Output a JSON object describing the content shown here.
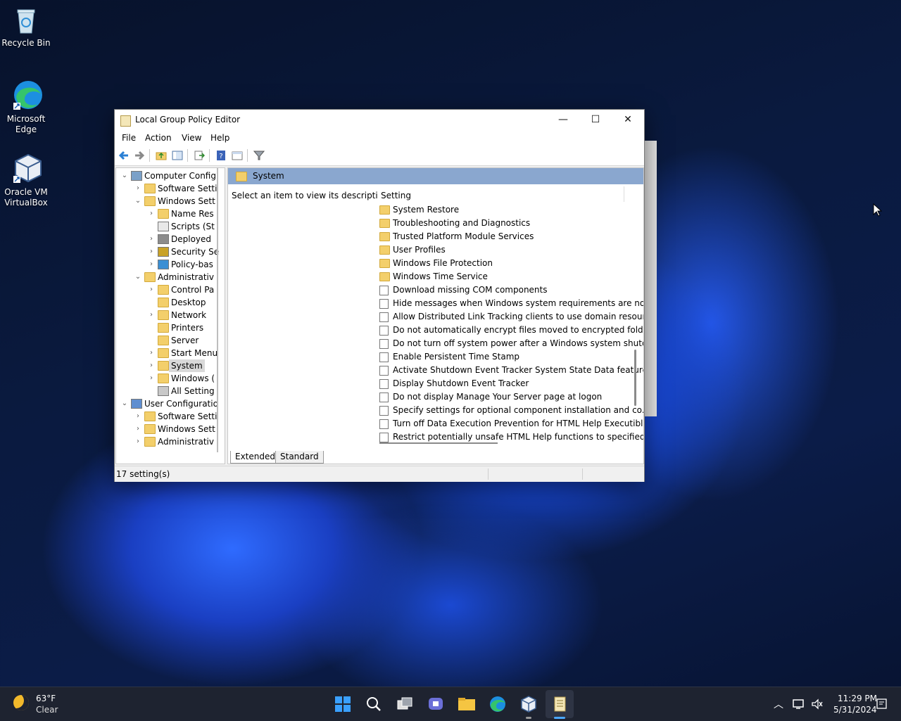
{
  "desktop": {
    "icons": [
      {
        "label": "Recycle Bin"
      },
      {
        "label": "Microsoft Edge"
      },
      {
        "label": "Oracle VM VirtualBox"
      }
    ]
  },
  "window": {
    "title": "Local Group Policy Editor",
    "controls": {
      "minimize": "—",
      "maximize": "☐",
      "close": "✕"
    },
    "menu": [
      "File",
      "Action",
      "View",
      "Help"
    ],
    "tree": [
      {
        "label": "Computer Config",
        "twisty": "⌄"
      },
      {
        "label": "Software Setti",
        "twisty": "›"
      },
      {
        "label": "Windows Sett",
        "twisty": "⌄"
      },
      {
        "label": "Name Res",
        "twisty": "›"
      },
      {
        "label": "Scripts (St",
        "twisty": ""
      },
      {
        "label": "Deployed",
        "twisty": "›"
      },
      {
        "label": "Security Se",
        "twisty": "›"
      },
      {
        "label": "Policy-bas",
        "twisty": "›"
      },
      {
        "label": "Administrativ",
        "twisty": "⌄"
      },
      {
        "label": "Control Pa",
        "twisty": "›"
      },
      {
        "label": "Desktop",
        "twisty": ""
      },
      {
        "label": "Network",
        "twisty": "›"
      },
      {
        "label": "Printers",
        "twisty": ""
      },
      {
        "label": "Server",
        "twisty": ""
      },
      {
        "label": "Start Menu",
        "twisty": "›"
      },
      {
        "label": "System",
        "twisty": "›"
      },
      {
        "label": "Windows (",
        "twisty": "›"
      },
      {
        "label": "All Setting",
        "twisty": ""
      },
      {
        "label": "User Configuratio",
        "twisty": "⌄"
      },
      {
        "label": "Software Setti",
        "twisty": "›"
      },
      {
        "label": "Windows Sett",
        "twisty": "›"
      },
      {
        "label": "Administrativ",
        "twisty": "›"
      }
    ],
    "pane": {
      "header": "System",
      "description": "Select an item to view its description.",
      "column": "Setting",
      "items": [
        "System Restore",
        "Troubleshooting and Diagnostics",
        "Trusted Platform Module Services",
        "User Profiles",
        "Windows File Protection",
        "Windows Time Service",
        "Download missing COM components",
        "Hide messages when Windows system requirements are not...",
        "Allow Distributed Link Tracking clients to use domain resour...",
        "Do not automatically encrypt files moved to encrypted fold...",
        "Do not turn off system power after a Windows system shutd...",
        "Enable Persistent Time Stamp",
        "Activate Shutdown Event Tracker System State Data feature",
        "Display Shutdown Event Tracker",
        "Do not display Manage Your Server page at logon",
        "Specify settings for optional component installation and co...",
        "Turn off Data Execution Prevention for HTML Help Executible",
        "Restrict potentially unsafe HTML Help functions to specified..."
      ]
    },
    "tabs": [
      "Extended",
      "Standard"
    ],
    "status": "17 setting(s)"
  },
  "taskbar": {
    "weather_temp": "63°F",
    "weather_cond": "Clear",
    "time": "11:29 PM",
    "date": "5/31/2024"
  }
}
